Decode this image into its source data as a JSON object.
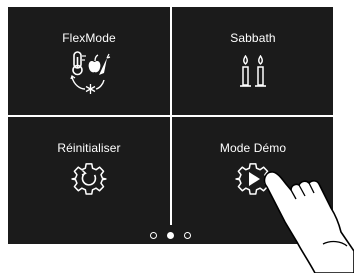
{
  "tiles": [
    {
      "label": "FlexMode",
      "icon": "temperature-flex-icon"
    },
    {
      "label": "Sabbath",
      "icon": "candles-icon"
    },
    {
      "label": "Réinitialiser",
      "icon": "reset-gear-icon"
    },
    {
      "label": "Mode Démo",
      "icon": "demo-play-gear-icon"
    }
  ],
  "pagination": {
    "pages": 3,
    "current": 2
  },
  "colors": {
    "panel": "#1b1b1b",
    "foreground": "#ffffff"
  },
  "overlay": {
    "icon": "pointing-hand-icon"
  }
}
